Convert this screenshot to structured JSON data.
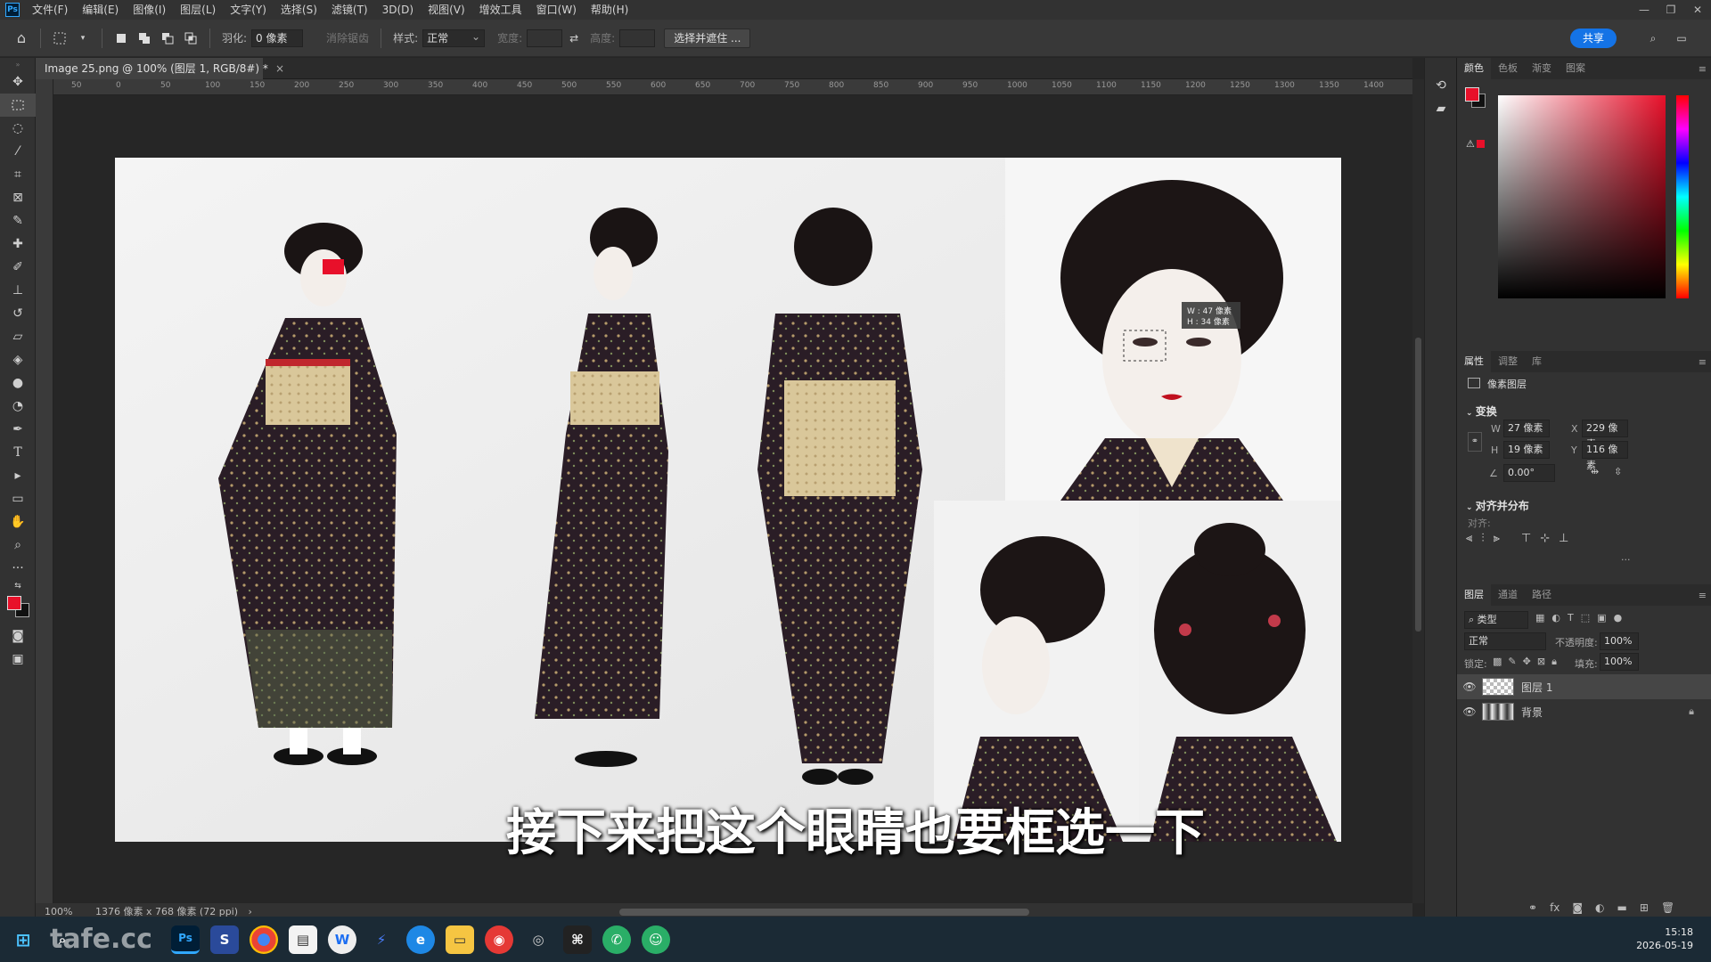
{
  "app": {
    "logo": "Ps"
  },
  "menu": [
    "文件(F)",
    "编辑(E)",
    "图像(I)",
    "图层(L)",
    "文字(Y)",
    "选择(S)",
    "滤镜(T)",
    "3D(D)",
    "视图(V)",
    "增效工具",
    "窗口(W)",
    "帮助(H)"
  ],
  "options": {
    "feather_label": "羽化:",
    "feather_value": "0 像素",
    "antialias_label": "消除锯齿",
    "style_label": "样式:",
    "style_value": "正常",
    "width_label": "宽度:",
    "height_label": "高度:",
    "select_mask_button": "选择并遮住 ...",
    "share_button": "共享"
  },
  "document": {
    "tab_title": "Image 25.png @ 100% (图层 1, RGB/8#) *"
  },
  "ruler_ticks": [
    "50",
    "0",
    "50",
    "100",
    "150",
    "200",
    "250",
    "300",
    "350",
    "400",
    "450",
    "500",
    "550",
    "600",
    "650",
    "700",
    "750",
    "800",
    "850",
    "900",
    "950",
    "1000",
    "1050",
    "1100",
    "1150",
    "1200",
    "1250",
    "1300",
    "1350",
    "1400"
  ],
  "selection_tooltip": {
    "w": "W : 47 像素",
    "h": "H : 34 像素"
  },
  "subtitle": "接下来把这个眼睛也要框选一下",
  "status": {
    "zoom": "100%",
    "info": "1376 像素 x 768 像素 (72 ppi)"
  },
  "panels": {
    "color_tabs": [
      "颜色",
      "色板",
      "渐变",
      "图案"
    ],
    "props_tabs": [
      "属性",
      "调整",
      "库"
    ],
    "layer_kind": "像素图层",
    "transform": {
      "title": "变换",
      "w": "27 像素",
      "x": "229 像素",
      "h": "19 像素",
      "y": "116 像素",
      "angle": "0.00°"
    },
    "align": {
      "title": "对齐并分布",
      "sub": "对齐:",
      "more": "..."
    },
    "layers_tabs": [
      "图层",
      "通道",
      "路径"
    ],
    "filter_kind": "类型",
    "blend_mode": "正常",
    "opacity_label": "不透明度:",
    "opacity_value": "100%",
    "lock_label": "锁定:",
    "fill_label": "填充:",
    "fill_value": "100%",
    "layers": [
      {
        "name": "图层 1"
      },
      {
        "name": "背景"
      }
    ]
  },
  "taskbar": {
    "clock_time": "15:18",
    "clock_date": "2026-05-19",
    "watermark": "tafe.cc",
    "ps_label": "Ps"
  },
  "colors": {
    "foreground": "#e8102a",
    "background": "#111111",
    "accent": "#1473e6"
  }
}
